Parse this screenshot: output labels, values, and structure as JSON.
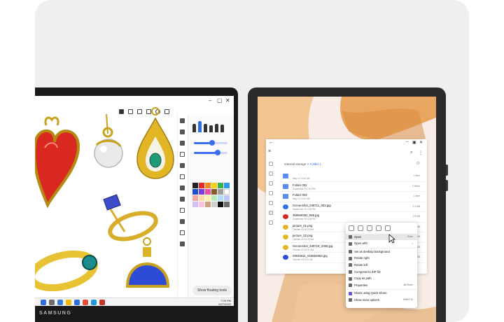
{
  "brand": "SAMSUNG",
  "laptop": {
    "floating_button": "Show floating tools",
    "clock_time": "7:05 PM",
    "clock_date": "2/27/2022",
    "palette": [
      "#222222",
      "#e02a2a",
      "#f28c1d",
      "#f5d219",
      "#38b24a",
      "#2e9be8",
      "#1b4fd3",
      "#7b3fd6",
      "#e84fa5",
      "#8a5a2b",
      "#9e9e9e",
      "#ffffff",
      "#f5a3a3",
      "#ffd8a8",
      "#fff1a8",
      "#b9e9b7",
      "#aedcf7",
      "#b8c7f5",
      "#d3c0f2",
      "#f7c3e0",
      "#c9a27e",
      "#cfcfcf",
      "#111111",
      "#6c6c6c"
    ]
  },
  "tablet": {
    "breadcrumb": {
      "root": "Internal storage",
      "sep": ">",
      "current": "Folder 1"
    },
    "files": [
      {
        "icon": "folder-icon",
        "name": "",
        "date": "May 11 10:32 AM",
        "size": "1 item"
      },
      {
        "icon": "folder-icon",
        "name": "Folder 002",
        "date": "September 09 2:41 PM",
        "size": "2 items"
      },
      {
        "icon": "folder-icon",
        "name": "Folder 003",
        "date": "May 11 10:32 AM",
        "size": "1 item"
      },
      {
        "icon": "image-icon",
        "name": "Screenshot_238711_003.jpg",
        "date": "September 09 4:38 PM",
        "size": "2.1 MB"
      },
      {
        "icon": "image-icon",
        "name": "350569352_556.jpg",
        "date": "September 09 4:38 PM",
        "size": "1.6 MB"
      },
      {
        "icon": "image-icon",
        "name": "picture_01.png",
        "date": "October 03 10:24 AM",
        "size": "3.0 MB"
      },
      {
        "icon": "image-icon",
        "name": "picture_02.png",
        "date": "October 03 10:26 AM",
        "size": "3.0 MB"
      },
      {
        "icon": "image-icon",
        "name": "Screenshot_238718_2355.jpg",
        "date": "October 03 10:31 AM",
        "size": "2.1 MB"
      },
      {
        "icon": "image-icon",
        "name": "29045511_615652963.jpg",
        "date": "October 03 9:41 AM",
        "size": "1.4 MB"
      }
    ],
    "context_menu": [
      {
        "label": "Open",
        "shortcut": "Enter",
        "highlight": true
      },
      {
        "label": "Open with",
        "shortcut": ">",
        "highlight": false
      },
      {
        "label": "Set as desktop background",
        "shortcut": "",
        "highlight": false
      },
      {
        "label": "Rotate right",
        "shortcut": "",
        "highlight": false
      },
      {
        "label": "Rotate left",
        "shortcut": "",
        "highlight": false
      },
      {
        "label": "Compress to ZIP file",
        "shortcut": "",
        "highlight": false
      },
      {
        "label": "Copy as path",
        "shortcut": "",
        "highlight": false
      },
      {
        "label": "Properties",
        "shortcut": "Alt+Enter",
        "highlight": false
      },
      {
        "label": "Share using Quick Share",
        "shortcut": "",
        "highlight": false
      },
      {
        "label": "Show more options",
        "shortcut": "Shift+F10",
        "highlight": false
      }
    ]
  }
}
